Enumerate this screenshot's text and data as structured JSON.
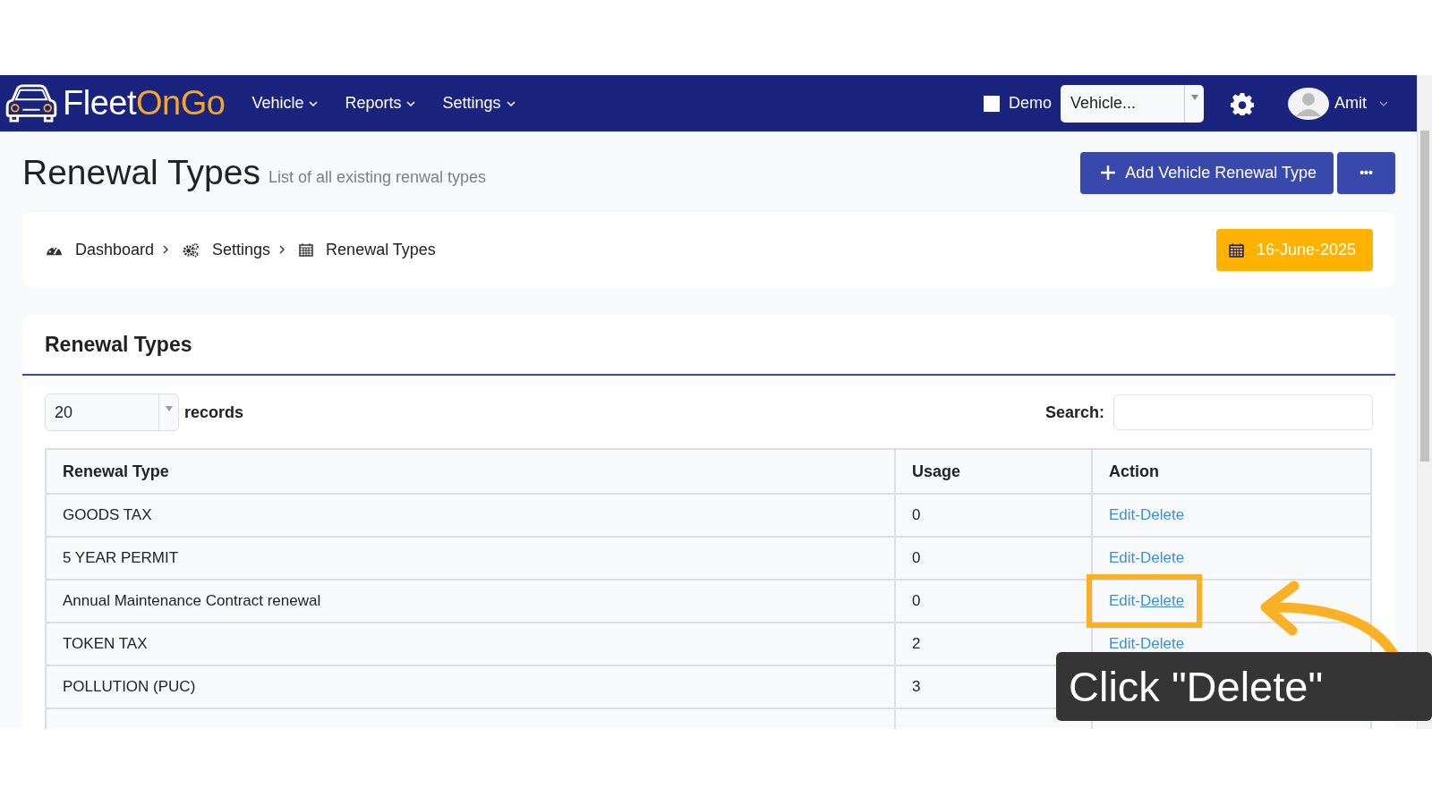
{
  "navbar": {
    "logo": {
      "part_1": "Fleet",
      "part_2": "OnGo"
    },
    "menu": [
      {
        "label": "Vehicle"
      },
      {
        "label": "Reports"
      },
      {
        "label": "Settings"
      }
    ],
    "demo": {
      "label": "Demo",
      "checked": false
    },
    "vehicle_select": {
      "value": "Vehicle..."
    },
    "user": {
      "name": "Amit"
    }
  },
  "page": {
    "title": "Renewal Types",
    "subtitle": "List of all existing renwal types",
    "add_button": "Add Vehicle Renewal Type",
    "more_button": "•••"
  },
  "breadcrumb": [
    {
      "label": "Dashboard"
    },
    {
      "label": "Settings"
    },
    {
      "label": "Renewal Types"
    }
  ],
  "date_button": "16-June-2025",
  "card": {
    "title": "Renewal Types",
    "page_size": "20",
    "records_label": "records",
    "search_label": "Search:"
  },
  "table": {
    "columns": [
      "Renewal Type",
      "Usage",
      "Action"
    ],
    "rows": [
      {
        "name": "GOODS TAX",
        "usage": "0",
        "edit": "Edit",
        "sep": "-",
        "delete": "Delete",
        "highlighted": false
      },
      {
        "name": "5 YEAR PERMIT",
        "usage": "0",
        "edit": "Edit",
        "sep": "-",
        "delete": "Delete",
        "highlighted": false
      },
      {
        "name": "Annual Maintenance Contract renewal",
        "usage": "0",
        "edit": "Edit",
        "sep": "-",
        "delete": "Delete",
        "highlighted": true
      },
      {
        "name": "TOKEN TAX",
        "usage": "2",
        "edit": "Edit",
        "sep": "-",
        "delete": "Delete",
        "highlighted": false
      },
      {
        "name": "POLLUTION (PUC)",
        "usage": "3"
      }
    ]
  },
  "callout": {
    "text": "Click \"Delete\""
  }
}
